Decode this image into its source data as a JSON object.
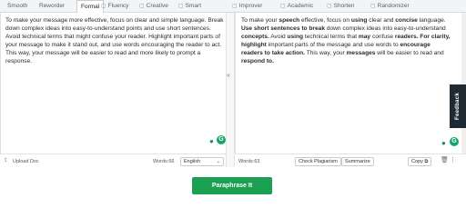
{
  "tabs": [
    {
      "label": "Smooth",
      "icon": ""
    },
    {
      "label": "Reworder",
      "icon": ""
    },
    {
      "label": "Formal",
      "icon": "",
      "active": true
    },
    {
      "label": "Fluency",
      "icon": "lock-icon"
    },
    {
      "label": "Creative",
      "icon": "lock-icon"
    },
    {
      "label": "Smart",
      "icon": "lock-icon"
    },
    {
      "label": "Improver",
      "icon": "lock-icon"
    },
    {
      "label": "Academic",
      "icon": "lock-icon"
    },
    {
      "label": "Shorten",
      "icon": "lock-icon"
    },
    {
      "label": "Randomizer",
      "icon": "lock-icon"
    }
  ],
  "input": {
    "text": "To make your message more effective, focus on clear and simple language. Break down complex ideas into easy-to-understand points and use short sentences. Avoid technical terms that might confuse your reader. Highlight important parts of your message to make it stand out, and use words encouraging the reader to act. This way, your message will be easier to read and more likely to prompt a response.",
    "upload_label": "Upload Doc",
    "word_count": "Words:66",
    "language": "English"
  },
  "output": {
    "segments": [
      {
        "t": "To make your ",
        "b": false
      },
      {
        "t": "speech",
        "b": true
      },
      {
        "t": " effective, focus on ",
        "b": false
      },
      {
        "t": "using",
        "b": true
      },
      {
        "t": " clear and ",
        "b": false
      },
      {
        "t": "concise",
        "b": true
      },
      {
        "t": " language. ",
        "b": false
      },
      {
        "t": "Use short sentences to break",
        "b": true
      },
      {
        "t": " down complex ideas into easy-to-understand ",
        "b": false
      },
      {
        "t": "concepts.",
        "b": true
      },
      {
        "t": " Avoid ",
        "b": false
      },
      {
        "t": "using",
        "b": true
      },
      {
        "t": " technical terms that ",
        "b": false
      },
      {
        "t": "may",
        "b": true
      },
      {
        "t": " confuse ",
        "b": false
      },
      {
        "t": "readers. For clarity, highlight",
        "b": true
      },
      {
        "t": " important parts of the message and use words to ",
        "b": false
      },
      {
        "t": "encourage readers to take action.",
        "b": true
      },
      {
        "t": " This way, your ",
        "b": false
      },
      {
        "t": "messages",
        "b": true
      },
      {
        "t": " will be easier to read and ",
        "b": false
      },
      {
        "t": "respond to.",
        "b": true
      }
    ],
    "word_count": "Words:63",
    "check_plagiarism_label": "Check Plagiarism",
    "summarize_label": "Summarize",
    "copy_label": "Copy"
  },
  "feedback_label": "Feedback",
  "paraphrase_button_label": "Paraphrase It",
  "colors": {
    "accent": "#1aa050",
    "badge": "#15a56a"
  }
}
